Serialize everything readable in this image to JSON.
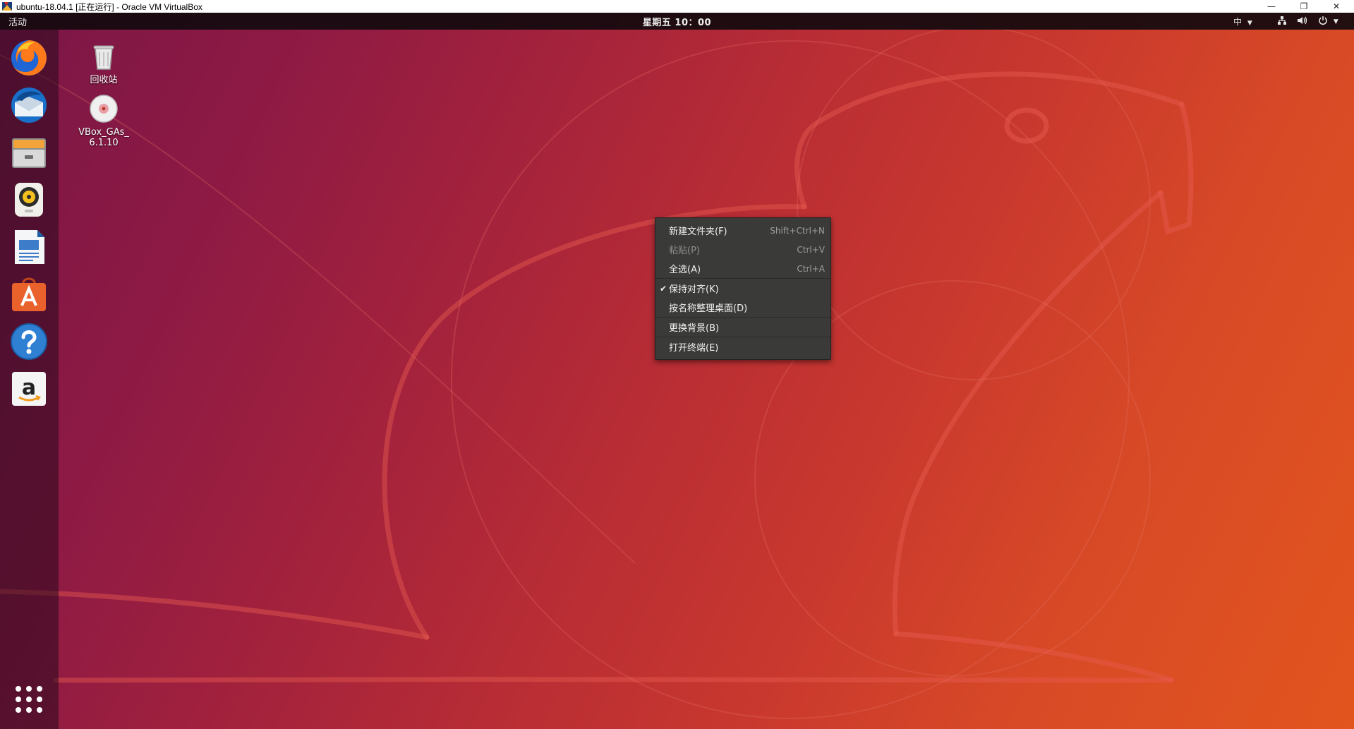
{
  "host_window": {
    "title": "ubuntu-18.04.1 [正在运行] - Oracle VM VirtualBox",
    "minimize_glyph": "—",
    "restore_glyph": "❐",
    "close_glyph": "✕"
  },
  "topbar": {
    "activities_label": "活动",
    "clock": "星期五 10：00",
    "input_method": "中"
  },
  "dock": {
    "items": [
      {
        "name": "firefox-icon"
      },
      {
        "name": "thunderbird-icon"
      },
      {
        "name": "files-icon"
      },
      {
        "name": "rhythmbox-icon"
      },
      {
        "name": "libreoffice-writer-icon"
      },
      {
        "name": "ubuntu-software-icon"
      },
      {
        "name": "help-icon"
      },
      {
        "name": "amazon-icon"
      }
    ]
  },
  "desktop": {
    "icons": [
      {
        "label": "回收站",
        "icon": "trash-icon"
      },
      {
        "label_line1": "VBox_GAs_",
        "label_line2": "6.1.10",
        "icon": "disc-icon"
      }
    ]
  },
  "context_menu": {
    "items": [
      {
        "label": "新建文件夹(F)",
        "shortcut": "Shift+Ctrl+N"
      },
      {
        "label": "粘贴(P)",
        "shortcut": "Ctrl+V",
        "disabled": true
      },
      {
        "label": "全选(A)",
        "shortcut": "Ctrl+A"
      },
      {
        "label": "保持对齐(K)",
        "checked": true,
        "check_glyph": "✔"
      },
      {
        "label": "按名称整理桌面(D)"
      },
      {
        "label": "更换背景(B)"
      },
      {
        "label": "打开终端(E)"
      }
    ]
  },
  "colors": {
    "menu_bg": "#3a3a38",
    "topbar_bg": "#120a0e",
    "wallpaper_start": "#7a1646",
    "wallpaper_end": "#e2551e"
  }
}
